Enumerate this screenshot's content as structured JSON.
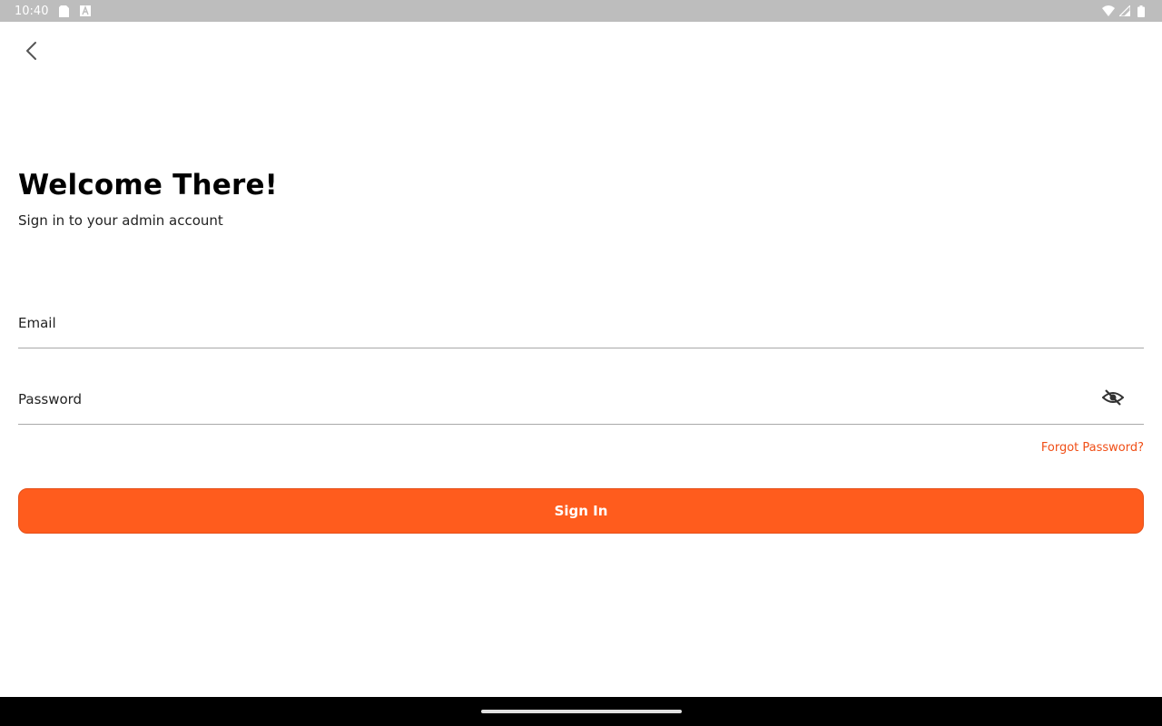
{
  "status_bar": {
    "time": "10:40",
    "icons_left": [
      "sim-card-icon",
      "notification-a-icon"
    ],
    "icons_right": [
      "wifi-icon",
      "signal-icon",
      "battery-icon"
    ]
  },
  "header": {
    "back_icon": "chevron-left-icon"
  },
  "login": {
    "title": "Welcome There!",
    "subtitle": "Sign in to your admin account",
    "email": {
      "placeholder": "Email",
      "value": ""
    },
    "password": {
      "placeholder": "Password",
      "value": "",
      "toggle_icon": "eye-off-icon"
    },
    "forgot_password": "Forgot Password?",
    "sign_in": "Sign In"
  },
  "colors": {
    "accent": "#ff5c1d",
    "link": "#f04e16",
    "status_bar": "#bdbdbd"
  }
}
